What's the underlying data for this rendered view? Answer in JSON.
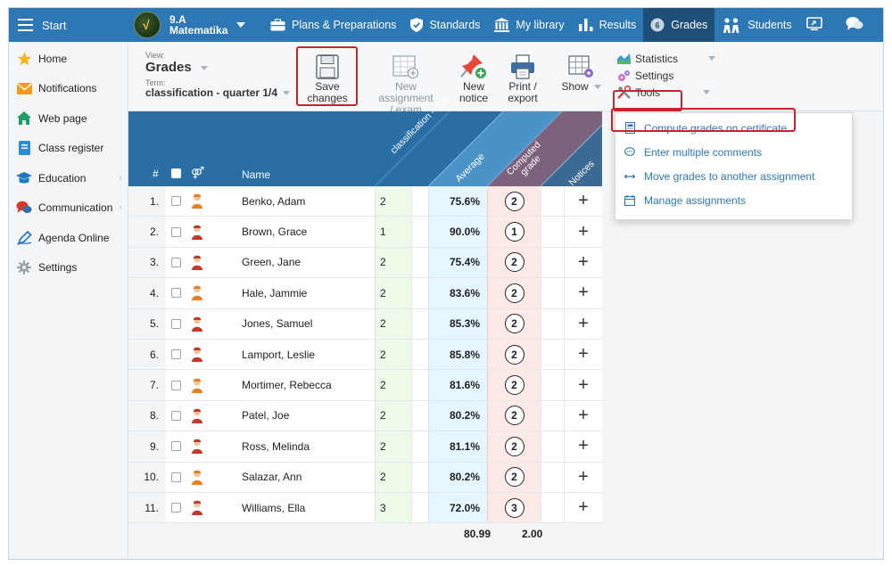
{
  "topbar": {
    "start_label": "Start",
    "class_name": "9.A",
    "class_subject": "Matematika",
    "items": [
      {
        "label": "Plans & Preparations",
        "icon": "briefcase-icon"
      },
      {
        "label": "Standards",
        "icon": "shield-icon"
      },
      {
        "label": "My library",
        "icon": "library-icon"
      },
      {
        "label": "Results",
        "icon": "bar-chart-icon"
      },
      {
        "label": "Grades",
        "icon": "grades-icon",
        "active": true
      },
      {
        "label": "Students",
        "icon": "students-icon"
      }
    ]
  },
  "sidebar": {
    "items": [
      {
        "label": "Home",
        "icon": "star-icon"
      },
      {
        "label": "Notifications",
        "icon": "envelope-icon"
      },
      {
        "label": "Web page",
        "icon": "house-icon"
      },
      {
        "label": "Class register",
        "icon": "register-icon"
      },
      {
        "label": "Education",
        "icon": "education-icon",
        "has_submenu": true
      },
      {
        "label": "Communication",
        "icon": "chat-icon",
        "has_submenu": true
      },
      {
        "label": "Agenda Online",
        "icon": "pen-icon"
      },
      {
        "label": "Settings",
        "icon": "gear-icon"
      }
    ]
  },
  "ribbon": {
    "view_label": "View:",
    "view_value": "Grades",
    "term_label": "Term:",
    "term_value": "classification - quarter 1/4",
    "save_label_1": "Save",
    "save_label_2": "changes",
    "new_assignment_1": "New assignment",
    "new_assignment_2": "/ exam",
    "new_notice_1": "New",
    "new_notice_2": "notice",
    "print_1": "Print /",
    "print_2": "export",
    "show_label": "Show",
    "statistics_label": "Statistics",
    "settings_label": "Settings",
    "tools_label": "Tools"
  },
  "tools_menu": {
    "items": [
      {
        "label": "Compute grades on certificate",
        "icon": "calculator-icon"
      },
      {
        "label": "Enter multiple comments",
        "icon": "comment-icon"
      },
      {
        "label": "Move grades to another assignment",
        "icon": "move-icon"
      },
      {
        "label": "Manage assignments",
        "icon": "calendar-icon"
      }
    ]
  },
  "table": {
    "headers": {
      "num": "#",
      "name": "Name",
      "classification": "classification - quar...",
      "average": "Average",
      "computed_1": "Computed",
      "computed_2": "grade",
      "notices": "Notices"
    },
    "rows": [
      {
        "num": "1.",
        "name": "Benko, Adam",
        "classification": "2",
        "average": "75.6%",
        "computed": "2",
        "gender": "male"
      },
      {
        "num": "2.",
        "name": "Brown, Grace",
        "classification": "1",
        "average": "90.0%",
        "computed": "1",
        "gender": "female"
      },
      {
        "num": "3.",
        "name": "Green, Jane",
        "classification": "2",
        "average": "75.4%",
        "computed": "2",
        "gender": "female"
      },
      {
        "num": "4.",
        "name": "Hale, Jammie",
        "classification": "2",
        "average": "83.6%",
        "computed": "2",
        "gender": "male"
      },
      {
        "num": "5.",
        "name": "Jones, Samuel",
        "classification": "2",
        "average": "85.3%",
        "computed": "2",
        "gender": "female"
      },
      {
        "num": "6.",
        "name": "Lamport, Leslie",
        "classification": "2",
        "average": "85.8%",
        "computed": "2",
        "gender": "female"
      },
      {
        "num": "7.",
        "name": "Mortimer, Rebecca",
        "classification": "2",
        "average": "81.6%",
        "computed": "2",
        "gender": "male"
      },
      {
        "num": "8.",
        "name": "Patel, Joe",
        "classification": "2",
        "average": "80.2%",
        "computed": "2",
        "gender": "female"
      },
      {
        "num": "9.",
        "name": "Ross, Melinda",
        "classification": "2",
        "average": "81.1%",
        "computed": "2",
        "gender": "female"
      },
      {
        "num": "10.",
        "name": "Salazar, Ann",
        "classification": "2",
        "average": "80.2%",
        "computed": "2",
        "gender": "male"
      },
      {
        "num": "11.",
        "name": "Williams, Ella",
        "classification": "3",
        "average": "72.0%",
        "computed": "3",
        "gender": "female"
      }
    ],
    "footer_average": "80.99",
    "footer_computed": "2.00"
  },
  "colors": {
    "topbar": "#2d77b4",
    "active_tab": "#1f4f78",
    "header": "#2a6ea6",
    "highlight_red": "#c5252d",
    "link_blue": "#2d77b4"
  }
}
